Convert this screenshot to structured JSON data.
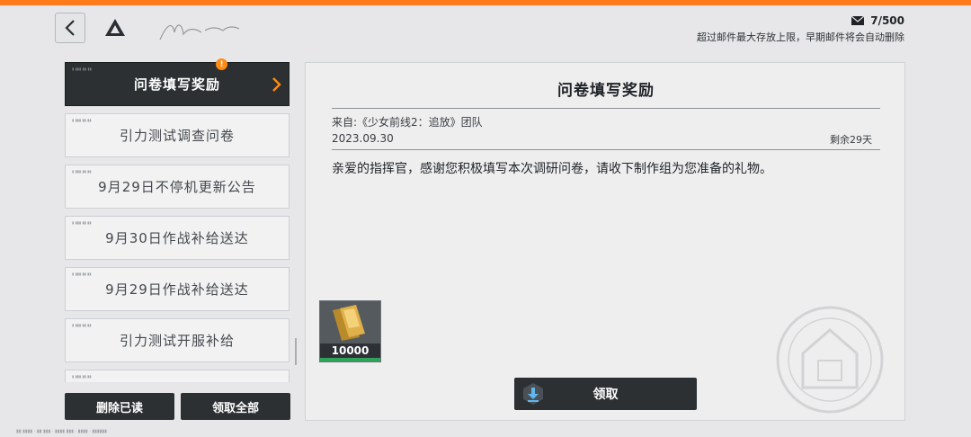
{
  "header": {
    "back_icon": "chevron-left-icon",
    "home_icon": "triangle-logo-icon",
    "mail_icon": "envelope-icon",
    "mail_count": "7/500",
    "storage_note": "超过邮件最大存放上限，早期邮件将会自动删除"
  },
  "mail_list": {
    "items": [
      {
        "title": "问卷填写奖励",
        "active": true,
        "unread": true
      },
      {
        "title": "引力测试调查问卷",
        "active": false
      },
      {
        "title": "9月29日不停机更新公告",
        "active": false
      },
      {
        "title": "9月30日作战补给送达",
        "active": false
      },
      {
        "title": "9月29日作战补给送达",
        "active": false
      },
      {
        "title": "引力测试开服补给",
        "active": false
      },
      {
        "title": "",
        "active": false
      }
    ],
    "unread_mark": "!"
  },
  "actions": {
    "delete_read": "删除已读",
    "claim_all": "领取全部"
  },
  "mail_detail": {
    "title": "问卷填写奖励",
    "from": "来自:《少女前线2：追放》团队",
    "date": "2023.09.30",
    "remaining": "剩余29天",
    "body": "亲爱的指挥官，感谢您积极填写本次调研问卷，请收下制作组为您准备的礼物。",
    "reward": {
      "icon": "gold-ingot-icon",
      "quantity": "10000"
    },
    "claim_label": "领取",
    "claim_icon": "download-icon"
  },
  "colors": {
    "accent": "#ff7a1a",
    "dark": "#2c3033",
    "reward_bar": "#2fa35a"
  }
}
